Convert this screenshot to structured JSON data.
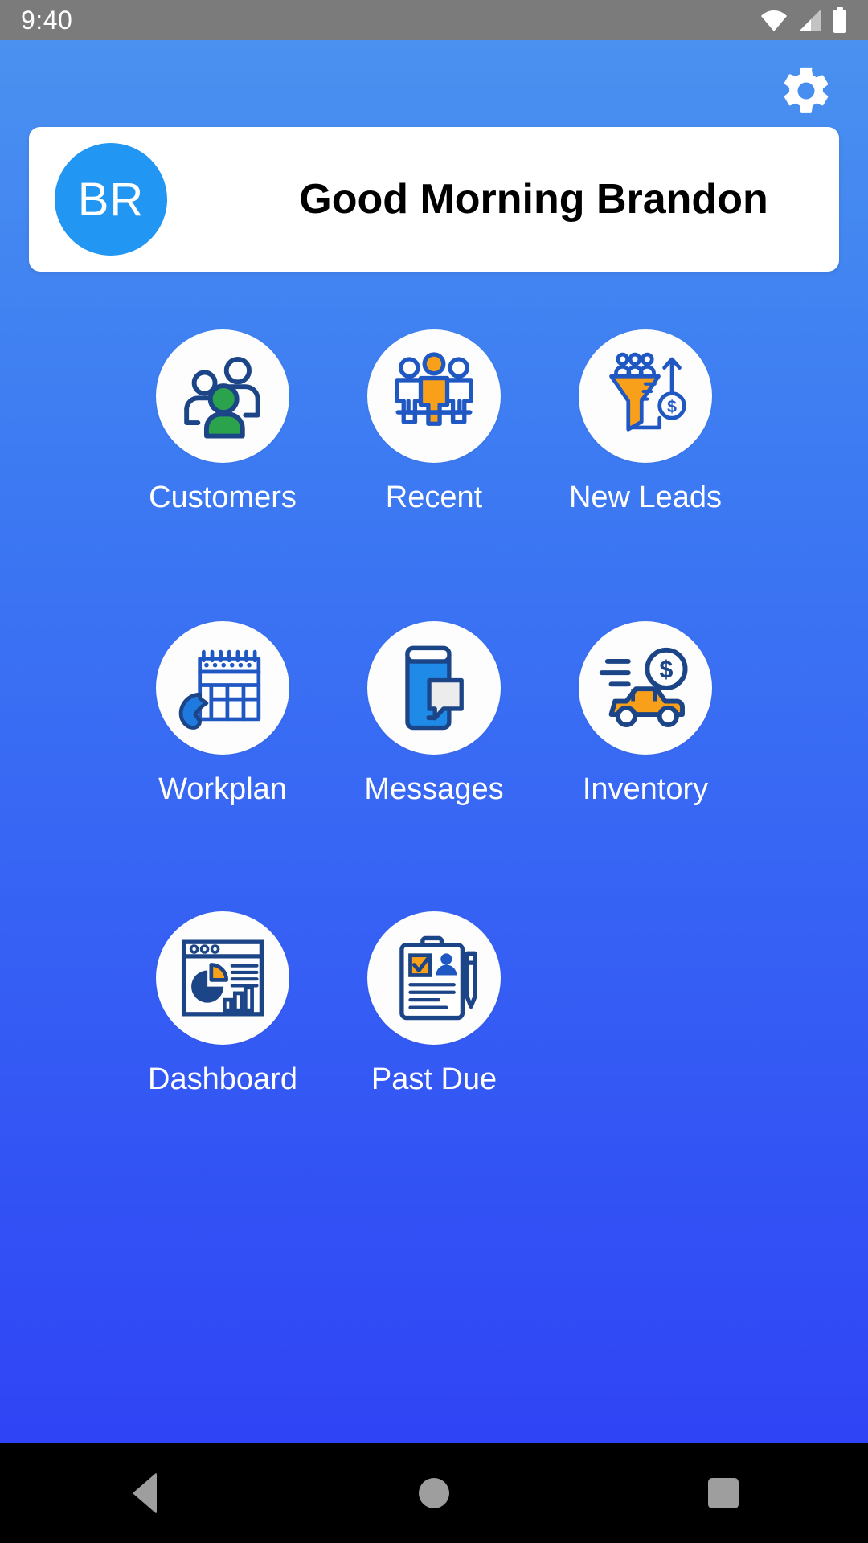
{
  "status_bar": {
    "time": "9:40",
    "icons": [
      "wifi-icon",
      "cellular-signal-icon",
      "battery-icon"
    ]
  },
  "header": {
    "settings_icon": "gear-icon"
  },
  "greeting": {
    "avatar_initials": "BR",
    "avatar_color": "#2196f3",
    "message": "Good Morning Brandon"
  },
  "theme": {
    "gradient_top": "#4a91f0",
    "gradient_bottom": "#2f44f5",
    "icon_navy": "#1c4587",
    "icon_blue": "#1f57c3",
    "icon_orange": "#f9a01b",
    "icon_green": "#2ba24c",
    "card_white": "#ffffff",
    "label_white": "#ffffff"
  },
  "menu": {
    "rows": [
      [
        {
          "id": "customers",
          "label": "Customers",
          "icon": "people-group-icon"
        },
        {
          "id": "recent",
          "label": "Recent",
          "icon": "meeting-people-icon"
        },
        {
          "id": "new-leads",
          "label": "New Leads",
          "icon": "sales-funnel-icon"
        }
      ],
      [
        {
          "id": "workplan",
          "label": "Workplan",
          "icon": "calendar-phone-icon"
        },
        {
          "id": "messages",
          "label": "Messages",
          "icon": "phone-chat-icon"
        },
        {
          "id": "inventory",
          "label": "Inventory",
          "icon": "car-dollar-icon"
        }
      ],
      [
        {
          "id": "dashboard",
          "label": "Dashboard",
          "icon": "analytics-window-icon"
        },
        {
          "id": "past-due",
          "label": "Past Due",
          "icon": "clipboard-pen-icon"
        }
      ]
    ]
  },
  "nav_bar": {
    "back_label": "Back",
    "home_label": "Home",
    "recents_label": "Recents"
  }
}
